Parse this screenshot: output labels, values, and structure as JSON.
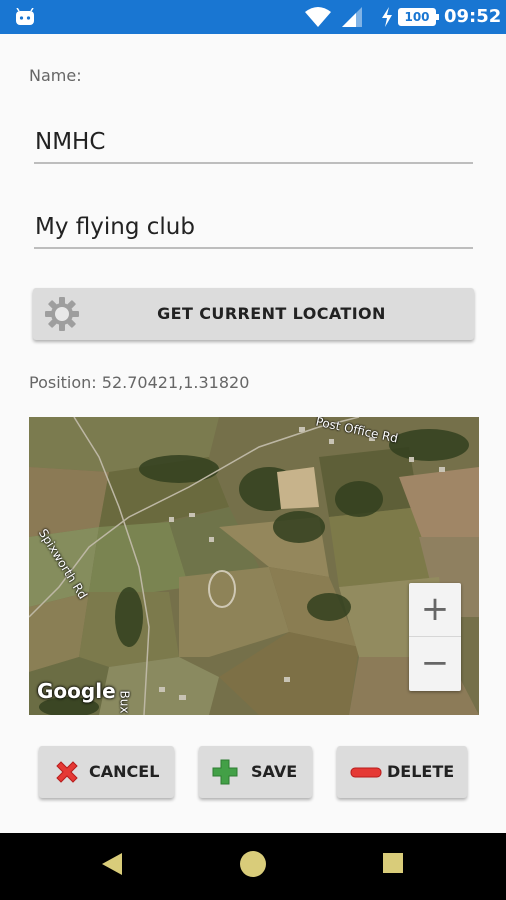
{
  "status_bar": {
    "battery_level": "100",
    "time": "09:52",
    "icons": [
      "android-icon",
      "wifi-icon",
      "signal-icon",
      "charging-icon",
      "battery-icon"
    ]
  },
  "form": {
    "name_label": "Name:",
    "name_value": "NMHC",
    "description_value": "My flying club",
    "get_location_label": "GET CURRENT LOCATION",
    "position_text": "Position: 52.70421,1.31820"
  },
  "map": {
    "road_labels": [
      "Post Office Rd",
      "Spixworth Rd",
      "Bux"
    ],
    "attribution": "Google",
    "zoom_in_label": "+",
    "zoom_out_label": "−"
  },
  "actions": {
    "cancel_label": "CANCEL",
    "save_label": "SAVE",
    "delete_label": "DELETE"
  },
  "colors": {
    "status_bar": "#1976d2",
    "button_bg": "#dcdcdc",
    "cancel_icon": "#e53935",
    "save_icon": "#43a047",
    "delete_icon": "#e53935"
  }
}
